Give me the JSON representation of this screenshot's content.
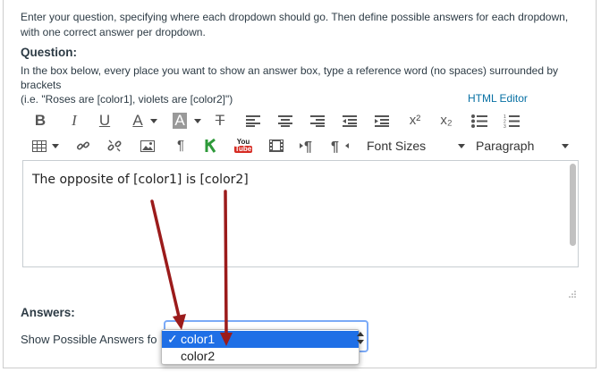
{
  "intro_text": "Enter your question, specifying where each dropdown should go. Then define possible answers for each dropdown, with one correct answer per dropdown.",
  "question": {
    "label": "Question:",
    "help_line1": "In the box below, every place you want to show an answer box, type a reference word (no spaces) surrounded by brackets",
    "help_line2": "(i.e. \"Roses are [color1], violets are [color2]\")"
  },
  "html_editor_link": "HTML Editor",
  "toolbar": {
    "row1": [
      "bold-icon",
      "italic-icon",
      "underline-icon",
      "text-color-icon",
      "background-color-icon",
      "clear-formatting-icon",
      "align-left-icon",
      "align-center-icon",
      "align-right-icon",
      "outdent-icon",
      "indent-icon",
      "superscript-icon",
      "subscript-icon",
      "bullet-list-icon",
      "numbered-list-icon"
    ],
    "row2": [
      "table-icon",
      "link-icon",
      "unlink-icon",
      "image-icon",
      "paragraph-mark-icon",
      "equation-icon",
      "youtube-icon",
      "media-icon",
      "ltr-icon",
      "rtl-icon"
    ],
    "bold_glyph": "B",
    "italic_glyph": "I",
    "underline_glyph": "U",
    "font_color_glyph": "A",
    "bg_color_glyph": "A",
    "clear_glyph": "T",
    "superscript_glyph": "x²",
    "subscript_glyph": "x₂",
    "pilcrow_glyph": "¶",
    "youtube_glyph_top": "You",
    "youtube_glyph_bottom": "Tube",
    "font_sizes_label": "Font Sizes",
    "paragraph_label": "Paragraph"
  },
  "editor": {
    "content": "The opposite of [color1] is [color2]"
  },
  "answers": {
    "label": "Answers:",
    "show_label": "Show Possible Answers fo"
  },
  "dropdown": {
    "options": [
      "color1",
      "color2"
    ],
    "selected": "color1",
    "checkmark": "✓"
  },
  "colors": {
    "arrow": "#9b1b1b",
    "selected_option": "#1f6fe6",
    "link": "#0770a3"
  }
}
